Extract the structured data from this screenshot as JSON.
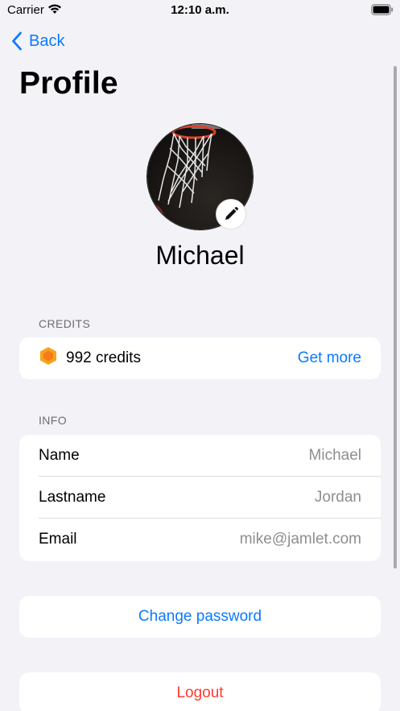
{
  "status_bar": {
    "carrier": "Carrier",
    "time": "12:10 a.m."
  },
  "nav": {
    "back_label": "Back",
    "title": "Profile"
  },
  "profile": {
    "name": "Michael"
  },
  "credits": {
    "section_header": "CREDITS",
    "amount_label": "992 credits",
    "get_more_label": "Get more"
  },
  "info": {
    "section_header": "INFO",
    "rows": [
      {
        "label": "Name",
        "value": "Michael"
      },
      {
        "label": "Lastname",
        "value": "Jordan"
      },
      {
        "label": "Email",
        "value": "mike@jamlet.com"
      }
    ]
  },
  "actions": {
    "change_password_label": "Change password",
    "logout_label": "Logout"
  },
  "colors": {
    "accent": "#0a7aff",
    "destructive": "#ff3b30",
    "credits_icon": "#f7a21b",
    "background": "#f2f2f7"
  }
}
